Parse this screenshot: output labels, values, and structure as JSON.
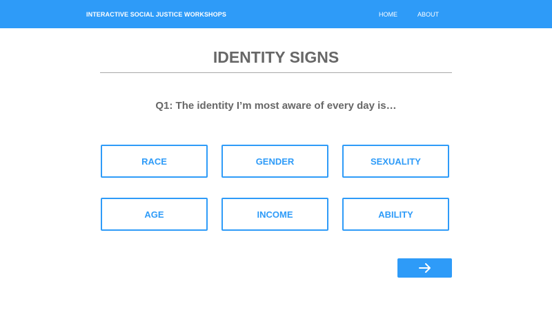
{
  "header": {
    "brand": "INTERACTIVE SOCIAL JUSTICE WORKSHOPS",
    "nav": [
      {
        "label": "HOME"
      },
      {
        "label": "ABOUT"
      }
    ]
  },
  "main": {
    "title": "IDENTITY SIGNS",
    "question": "Q1: The identity I’m most aware of every day is…",
    "options": [
      {
        "label": "RACE"
      },
      {
        "label": "GENDER"
      },
      {
        "label": "SEXUALITY"
      },
      {
        "label": "AGE"
      },
      {
        "label": "INCOME"
      },
      {
        "label": "ABILITY"
      }
    ],
    "next_button": {
      "icon": "arrow-right-icon"
    }
  },
  "colors": {
    "accent": "#2e9bf8",
    "heading_text": "#676767",
    "divider": "#a8a8a8",
    "background": "#ffffff"
  }
}
